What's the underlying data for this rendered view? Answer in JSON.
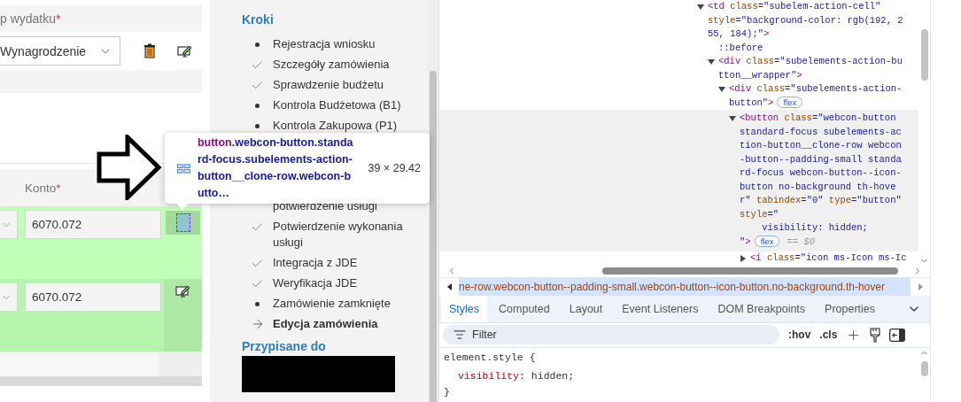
{
  "form": {
    "type_label": {
      "text": "p wydatku",
      "required_mark": "*"
    },
    "type_select": {
      "value": "Wynagrodzenie"
    },
    "column_header": {
      "text": "Konto",
      "required_mark": "*"
    },
    "rows": [
      {
        "account": "6070.072",
        "kind": "inspected"
      },
      {
        "account": "6070.072",
        "kind": "edit"
      }
    ]
  },
  "inspect_tooltip": {
    "tag": "button",
    "classes": ".webcon-button.standard-focus.subelements-action-button__clone-row.webcon-butto…",
    "size": "39 × 29.42"
  },
  "steps_panel": {
    "title": "Kroki",
    "steps": [
      {
        "label": "Rejestracja wniosku",
        "kind": "dot",
        "current": false
      },
      {
        "label": "Szczegóły zamówienia",
        "kind": "check",
        "current": false
      },
      {
        "label": "Sprawdzenie budżetu",
        "kind": "check",
        "current": false
      },
      {
        "label": "Kontrola Budżetowa (B1)",
        "kind": "dot",
        "current": false
      },
      {
        "label": "Kontrola Zakupowa (P1)",
        "kind": "dot",
        "current": false
      },
      {
        "label": "potwierdzenie usługi",
        "kind": "covered",
        "current": false
      },
      {
        "label": "Potwierdzenie wykonania usługi",
        "kind": "check",
        "current": false
      },
      {
        "label": "Integracja z JDE",
        "kind": "check",
        "current": false
      },
      {
        "label": "Weryfikacja JDE",
        "kind": "check",
        "current": false
      },
      {
        "label": "Zamówienie zamknięte",
        "kind": "dot",
        "current": false
      },
      {
        "label": "Edycja zamówienia",
        "kind": "arrow",
        "current": true
      }
    ],
    "assigned_title": "Przypisane do"
  },
  "devtools": {
    "tree": {
      "kind": "element",
      "expanded": true,
      "selected": false,
      "lines": [
        [
          {
            "kind": "tag",
            "text": "<td"
          },
          {
            "kind": "attr",
            "text": " class"
          },
          {
            "kind": "value",
            "text": "=\"subelem-action-cell\""
          }
        ],
        [
          {
            "kind": "attr",
            "text": "style"
          },
          {
            "kind": "value",
            "text": "=\"background-color: rgb(192, 2"
          }
        ],
        [
          {
            "kind": "value",
            "text": "55, 184);\""
          },
          {
            "kind": "tag",
            "text": ">"
          }
        ]
      ],
      "children": [
        {
          "kind": "pseudo",
          "selected": false,
          "lines": [
            [
              {
                "kind": "pseudo",
                "text": "::before"
              }
            ]
          ]
        },
        {
          "kind": "element",
          "expanded": true,
          "selected": false,
          "lines": [
            [
              {
                "kind": "tag",
                "text": "<div"
              },
              {
                "kind": "attr",
                "text": " class"
              },
              {
                "kind": "value",
                "text": "=\"subelements-action-bu"
              }
            ],
            [
              {
                "kind": "value",
                "text": "tton__wrapper\""
              },
              {
                "kind": "tag",
                "text": ">"
              }
            ]
          ],
          "children": [
            {
              "kind": "element",
              "expanded": true,
              "selected": false,
              "lines": [
                [
                  {
                    "kind": "tag",
                    "text": "<div"
                  },
                  {
                    "kind": "attr",
                    "text": " class"
                  },
                  {
                    "kind": "value",
                    "text": "=\"subelements-action-"
                  }
                ],
                [
                  {
                    "kind": "value",
                    "text": "button\""
                  },
                  {
                    "kind": "tag",
                    "text": ">"
                  },
                  {
                    "kind": "badge",
                    "text": "flex"
                  }
                ]
              ],
              "children": [
                {
                  "kind": "element",
                  "expanded": true,
                  "selected": true,
                  "lines": [
                    [
                      {
                        "kind": "tag",
                        "text": "<button"
                      },
                      {
                        "kind": "attr",
                        "text": " class"
                      },
                      {
                        "kind": "value",
                        "text": "=\"webcon-button"
                      }
                    ],
                    [
                      {
                        "kind": "value",
                        "text": "standard-focus subelements-ac"
                      }
                    ],
                    [
                      {
                        "kind": "value",
                        "text": "tion-button__clone-row webcon"
                      }
                    ],
                    [
                      {
                        "kind": "value",
                        "text": "-button--padding-small standa"
                      }
                    ],
                    [
                      {
                        "kind": "value",
                        "text": "rd-focus webcon-button--icon-"
                      }
                    ],
                    [
                      {
                        "kind": "value",
                        "text": "button no-background th-hove"
                      }
                    ],
                    [
                      {
                        "kind": "value",
                        "text": "r\""
                      },
                      {
                        "kind": "attr",
                        "text": " tabindex"
                      },
                      {
                        "kind": "value",
                        "text": "=\"0\""
                      },
                      {
                        "kind": "attr",
                        "text": " type"
                      },
                      {
                        "kind": "value",
                        "text": "=\"button\""
                      }
                    ],
                    [
                      {
                        "kind": "attr",
                        "text": "style"
                      },
                      {
                        "kind": "value",
                        "text": "=\""
                      }
                    ],
                    [
                      {
                        "kind": "value",
                        "text": "    visibility: hidden;"
                      }
                    ],
                    [
                      {
                        "kind": "value",
                        "text": "\""
                      },
                      {
                        "kind": "tag",
                        "text": ">"
                      },
                      {
                        "kind": "badge",
                        "text": "flex"
                      },
                      {
                        "kind": "hint",
                        "text": "== $0"
                      }
                    ]
                  ],
                  "children": [
                    {
                      "kind": "element",
                      "expanded": false,
                      "selected": false,
                      "lines": [
                        [
                          {
                            "kind": "tag",
                            "text": "<i"
                          },
                          {
                            "kind": "attr",
                            "text": " class"
                          },
                          {
                            "kind": "value",
                            "text": "=\"icon ms-Icon ms-Ic"
                          }
                        ]
                      ]
                    }
                  ]
                }
              ]
            }
          ]
        }
      ]
    },
    "breadcrumb": "ne-row.webcon-button--padding-small.webcon-button--icon-button.no-background.th-hover",
    "tabs": [
      {
        "label": "Styles",
        "selected": true
      },
      {
        "label": "Computed",
        "selected": false
      },
      {
        "label": "Layout",
        "selected": false
      },
      {
        "label": "Event Listeners",
        "selected": false
      },
      {
        "label": "DOM Breakpoints",
        "selected": false
      },
      {
        "label": "Properties",
        "selected": false
      }
    ],
    "filter": {
      "placeholder": "Filter"
    },
    "toolbar": [
      ":hov",
      ".cls"
    ],
    "styles": {
      "selector": "element.style",
      "open": "{",
      "declarations": [
        {
          "property": "visibility",
          "separator": ":",
          "value": "hidden;"
        }
      ],
      "close": "}"
    }
  }
}
